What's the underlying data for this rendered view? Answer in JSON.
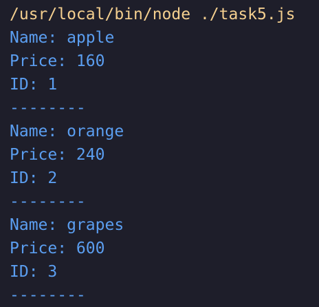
{
  "colors": {
    "background": "#1e1e2a",
    "command": "#f4cf8f",
    "output": "#5b9ef0"
  },
  "command": "/usr/local/bin/node ./task5.js",
  "output_lines": [
    "Name: apple",
    "Price: 160",
    "ID: 1",
    "--------",
    "Name: orange",
    "Price: 240",
    "ID: 2",
    "--------",
    "Name: grapes",
    "Price: 600",
    "ID: 3",
    "--------"
  ]
}
